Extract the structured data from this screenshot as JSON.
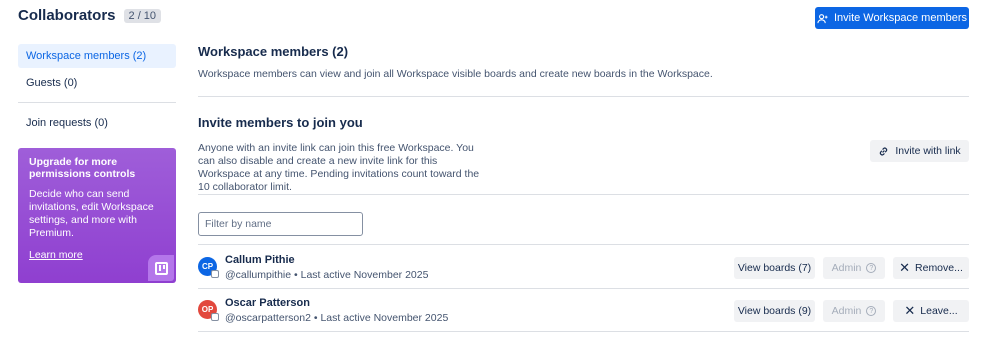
{
  "header": {
    "title": "Collaborators",
    "count": "2 / 10"
  },
  "toolbar": {
    "invite_workspace_label": "Invite Workspace members"
  },
  "sidebar": {
    "items": [
      {
        "label": "Workspace members (2)"
      },
      {
        "label": "Guests (0)"
      },
      {
        "label": "Join requests (0)"
      }
    ]
  },
  "upgrade": {
    "title": "Upgrade for more permissions controls",
    "body": "Decide who can send invitations, edit Workspace settings, and more with Premium.",
    "link": "Learn more"
  },
  "main": {
    "heading": "Workspace members (2)",
    "description": "Workspace members can view and join all Workspace visible boards and create new boards in the Workspace.",
    "invite_heading": "Invite members to join you",
    "invite_description": "Anyone with an invite link can join this free Workspace. You can also disable and create a new invite link for this Workspace at any time. Pending invitations count toward the 10 collaborator limit.",
    "invite_link_label": "Invite with link",
    "filter_placeholder": "Filter by name"
  },
  "members": [
    {
      "initials": "CP",
      "avatar_color": "#0c66e4",
      "name": "Callum Pithie",
      "meta": "@callumpithie • Last active November 2025",
      "view_boards": "View boards (7)",
      "role": "Admin",
      "action": "Remove..."
    },
    {
      "initials": "OP",
      "avatar_color": "#e2483d",
      "name": "Oscar Patterson",
      "meta": "@oscarpatterson2 • Last active November 2025",
      "view_boards": "View boards (9)",
      "role": "Admin",
      "action": "Leave..."
    }
  ]
}
